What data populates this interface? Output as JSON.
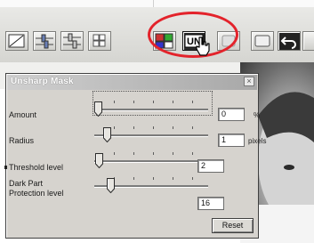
{
  "app": {
    "toolbar_icons": [
      "tone-curve-icon",
      "brightness-contrast-icon",
      "rgb-balance-icon",
      "hsl-icon",
      "selective-color-icon",
      "unsharp-mask-icon",
      "blank-tool-icon",
      "snapshot-icon",
      "undo-icon"
    ],
    "highlight_color": "#e3232b"
  },
  "dialog": {
    "title": "Unsharp Mask",
    "close_glyph": "×",
    "rows": [
      {
        "label": "Amount",
        "value": "0",
        "unit": "%",
        "level": 0.0
      },
      {
        "label": "Radius",
        "value": "1",
        "unit": "pixels",
        "level": 0.08
      },
      {
        "label": "Threshold level",
        "value": "2",
        "unit": "",
        "level": 0.01
      },
      {
        "label": "Dark Part\nProtection level",
        "value": "16",
        "unit": "",
        "level": 0.12
      }
    ],
    "reset_label": "Reset"
  }
}
